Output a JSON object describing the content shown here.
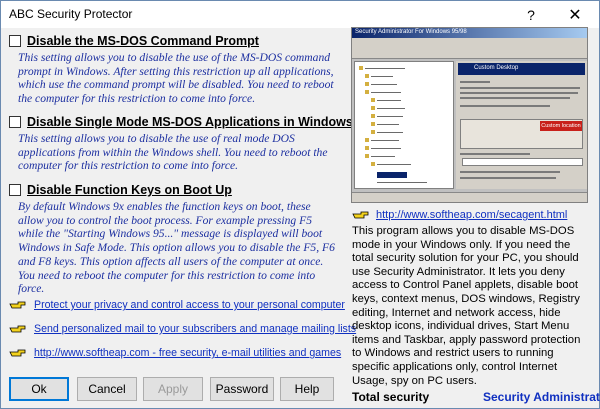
{
  "window": {
    "title": "ABC Security Protector",
    "help_glyph": "?",
    "close_glyph": "✕"
  },
  "options": [
    {
      "title": "Disable the MS-DOS Command Prompt",
      "description": "This setting allows you to disable the use of the MS-DOS command prompt in Windows. After setting this restriction up all applications, which use the command prompt will be disabled. You need to reboot the computer for this restriction to come into force.",
      "checked": false
    },
    {
      "title": "Disable Single Mode MS-DOS Applications in Windows",
      "description": "This setting allows you to disable the use of real mode DOS applications from within the Windows shell. You need to reboot the computer for this restriction to come into force.",
      "checked": false
    },
    {
      "title": "Disable Function Keys on Boot Up",
      "description": "By default Windows 9x enables the function keys on boot, these allow you to control the boot process. For example pressing F5 while the \"Starting Windows 95...\" message is displayed will boot Windows in Safe Mode. This option allows you to disable the F5, F6 and F8 keys. This option affects all users of the computer at once. You need to reboot the computer for this restriction to come into force.",
      "checked": false
    }
  ],
  "links": [
    {
      "text": "Protect your privacy and control access to your personal computer",
      "icon": "pointing-hand-icon"
    },
    {
      "text": "Send personalized mail to your subscribers and manage mailing lists",
      "icon": "pointing-hand-icon"
    },
    {
      "text": "http://www.softheap.com - free security, e-mail utilities and games",
      "icon": "pointing-hand-icon"
    }
  ],
  "buttons": {
    "ok": "Ok",
    "cancel": "Cancel",
    "apply": "Apply",
    "password": "Password",
    "help": "Help"
  },
  "preview": {
    "title": "Security Administrator For Windows 95/98",
    "pane_heading": "Custom Desktop",
    "custom_location_label": "Custom location"
  },
  "right_panel": {
    "link_text": "http://www.softheap.com/secagent.html",
    "info_text": "This program allows you to disable MS-DOS mode in your Windows only. If you need the total security solution for your PC, you should use Security Administrator. It lets you deny access to Control Panel applets, disable boot keys, context menus, DOS windows, Registry editing, Internet and network access, hide desktop icons, individual drives, Start Menu items and Taskbar, apply password protection to Windows and restrict users to running specific applications only, control Internet Usage, spy on PC users.",
    "footer_left": "Total security",
    "footer_right": "Security Administrator"
  },
  "colors": {
    "description_text": "#1c2fa0",
    "link_text": "#1030c0",
    "default_button_border": "#0078d7",
    "preview_accent": "#0a246a",
    "custom_location_badge": "#c8201a"
  }
}
